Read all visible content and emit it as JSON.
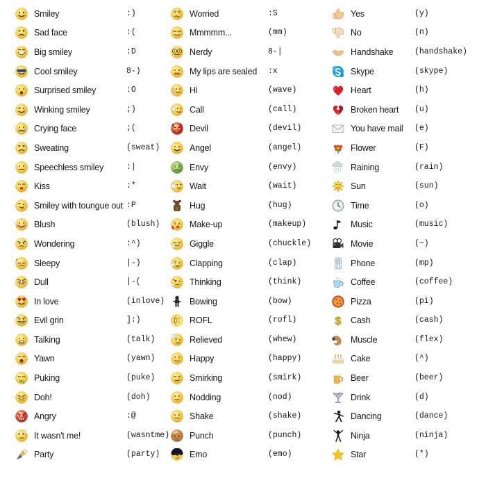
{
  "page": {
    "title": "Skype Emoticons List",
    "background_color": "#ffffff",
    "text_color": "#161616",
    "columns_count": 3,
    "rows_per_column": 25
  },
  "columns": [
    {
      "name": "column-1-smileys",
      "rows": [
        {
          "icon": "smiley-icon",
          "name": "Smiley",
          "code": ":)"
        },
        {
          "icon": "sad-face-icon",
          "name": "Sad face",
          "code": ":("
        },
        {
          "icon": "big-smiley-icon",
          "name": "Big smiley",
          "code": ":D"
        },
        {
          "icon": "cool-smiley-icon",
          "name": "Cool smiley",
          "code": "8-)"
        },
        {
          "icon": "surprised-smiley-icon",
          "name": "Surprised smiley",
          "code": ":O"
        },
        {
          "icon": "winking-smiley-icon",
          "name": "Winking smiley",
          "code": ";)"
        },
        {
          "icon": "crying-face-icon",
          "name": "Crying face",
          "code": ";("
        },
        {
          "icon": "sweating-icon",
          "name": "Sweating",
          "code": "(sweat)"
        },
        {
          "icon": "speechless-smiley-icon",
          "name": "Speechless smiley",
          "code": ":|"
        },
        {
          "icon": "kiss-icon",
          "name": "Kiss",
          "code": ":*"
        },
        {
          "icon": "tongue-out-icon",
          "name": "Smiley with toungue out",
          "code": ":P"
        },
        {
          "icon": "blush-icon",
          "name": "Blush",
          "code": "(blush)"
        },
        {
          "icon": "wondering-icon",
          "name": "Wondering",
          "code": ":^)"
        },
        {
          "icon": "sleepy-icon",
          "name": "Sleepy",
          "code": "|-)"
        },
        {
          "icon": "dull-icon",
          "name": "Dull",
          "code": "|-("
        },
        {
          "icon": "in-love-icon",
          "name": "In love",
          "code": "(inlove)"
        },
        {
          "icon": "evil-grin-icon",
          "name": "Evil grin",
          "code": "]:)"
        },
        {
          "icon": "talking-icon",
          "name": "Talking",
          "code": "(talk)"
        },
        {
          "icon": "yawn-icon",
          "name": "Yawn",
          "code": "(yawn)"
        },
        {
          "icon": "puking-icon",
          "name": "Puking",
          "code": "(puke)"
        },
        {
          "icon": "doh-icon",
          "name": "Doh!",
          "code": "(doh)"
        },
        {
          "icon": "angry-icon",
          "name": "Angry",
          "code": ":@"
        },
        {
          "icon": "it-wasnt-me-icon",
          "name": "It wasn't me!",
          "code": "(wasntme)"
        },
        {
          "icon": "party-icon",
          "name": "Party",
          "code": "(party)"
        }
      ]
    },
    {
      "name": "column-2-expressions",
      "rows": [
        {
          "icon": "worried-icon",
          "name": "Worried",
          "code": ":S"
        },
        {
          "icon": "mmmmm-icon",
          "name": "Mmmmm...",
          "code": "(mm)"
        },
        {
          "icon": "nerdy-icon",
          "name": "Nerdy",
          "code": "8-|"
        },
        {
          "icon": "lips-sealed-icon",
          "name": "My lips are sealed",
          "code": ":x"
        },
        {
          "icon": "hi-wave-icon",
          "name": "Hi",
          "code": "(wave)"
        },
        {
          "icon": "call-icon",
          "name": "Call",
          "code": "(call)"
        },
        {
          "icon": "devil-icon",
          "name": "Devil",
          "code": "(devil)"
        },
        {
          "icon": "angel-icon",
          "name": "Angel",
          "code": "(angel)"
        },
        {
          "icon": "envy-icon",
          "name": "Envy",
          "code": "(envy)"
        },
        {
          "icon": "wait-icon",
          "name": "Wait",
          "code": "(wait)"
        },
        {
          "icon": "hug-icon",
          "name": "Hug",
          "code": "(hug)"
        },
        {
          "icon": "make-up-icon",
          "name": "Make-up",
          "code": "(makeup)"
        },
        {
          "icon": "giggle-icon",
          "name": "Giggle",
          "code": "(chuckle)"
        },
        {
          "icon": "clapping-icon",
          "name": "Clapping",
          "code": "(clap)"
        },
        {
          "icon": "thinking-icon",
          "name": "Thinking",
          "code": "(think)"
        },
        {
          "icon": "bowing-icon",
          "name": "Bowing",
          "code": "(bow)"
        },
        {
          "icon": "rofl-icon",
          "name": "ROFL",
          "code": "(rofl)"
        },
        {
          "icon": "relieved-icon",
          "name": "Relieved",
          "code": "(whew)"
        },
        {
          "icon": "happy-icon",
          "name": "Happy",
          "code": "(happy)"
        },
        {
          "icon": "smirking-icon",
          "name": "Smirking",
          "code": "(smirk)"
        },
        {
          "icon": "nodding-icon",
          "name": "Nodding",
          "code": "(nod)"
        },
        {
          "icon": "shake-icon",
          "name": "Shake",
          "code": "(shake)"
        },
        {
          "icon": "punch-icon",
          "name": "Punch",
          "code": "(punch)"
        },
        {
          "icon": "emo-icon",
          "name": "Emo",
          "code": "(emo)"
        }
      ]
    },
    {
      "name": "column-3-objects",
      "rows": [
        {
          "icon": "thumbs-up-icon",
          "name": "Yes",
          "code": "(y)"
        },
        {
          "icon": "thumbs-down-icon",
          "name": "No",
          "code": "(n)"
        },
        {
          "icon": "handshake-icon",
          "name": "Handshake",
          "code": "(handshake)"
        },
        {
          "icon": "skype-icon",
          "name": "Skype",
          "code": "(skype)"
        },
        {
          "icon": "heart-icon",
          "name": "Heart",
          "code": "(h)"
        },
        {
          "icon": "broken-heart-icon",
          "name": "Broken heart",
          "code": "(u)"
        },
        {
          "icon": "mail-icon",
          "name": "You have mail",
          "code": "(e)"
        },
        {
          "icon": "flower-icon",
          "name": "Flower",
          "code": "(F)"
        },
        {
          "icon": "raining-icon",
          "name": "Raining",
          "code": "(rain)"
        },
        {
          "icon": "sun-icon",
          "name": "Sun",
          "code": "(sun)"
        },
        {
          "icon": "time-clock-icon",
          "name": "Time",
          "code": "(o)"
        },
        {
          "icon": "music-note-icon",
          "name": "Music",
          "code": "(music)"
        },
        {
          "icon": "movie-camera-icon",
          "name": "Movie",
          "code": "(~)"
        },
        {
          "icon": "phone-icon",
          "name": "Phone",
          "code": "(mp)"
        },
        {
          "icon": "coffee-icon",
          "name": "Coffee",
          "code": "(coffee)"
        },
        {
          "icon": "pizza-icon",
          "name": "Pizza",
          "code": "(pi)"
        },
        {
          "icon": "cash-icon",
          "name": "Cash",
          "code": "(cash)"
        },
        {
          "icon": "muscle-icon",
          "name": "Muscle",
          "code": "(flex)"
        },
        {
          "icon": "cake-icon",
          "name": "Cake",
          "code": "(^)"
        },
        {
          "icon": "beer-icon",
          "name": "Beer",
          "code": "(beer)"
        },
        {
          "icon": "drink-icon",
          "name": "Drink",
          "code": "(d)"
        },
        {
          "icon": "dancing-icon",
          "name": "Dancing",
          "code": "(dance)"
        },
        {
          "icon": "ninja-icon",
          "name": "Ninja",
          "code": "(ninja)"
        },
        {
          "icon": "star-icon",
          "name": "Star",
          "code": "(*)"
        }
      ]
    }
  ],
  "palette": {
    "smiley_yellow": "#f7d34f",
    "smiley_yellow_dark": "#e8a92b",
    "red": "#d42323",
    "green": "#6aa84f",
    "blue": "#3ba7dd",
    "skin": "#f0c08a",
    "brown": "#6b4a24",
    "purple": "#7a4fa3",
    "gray": "#9a9a9a",
    "gold": "#f2b705"
  }
}
